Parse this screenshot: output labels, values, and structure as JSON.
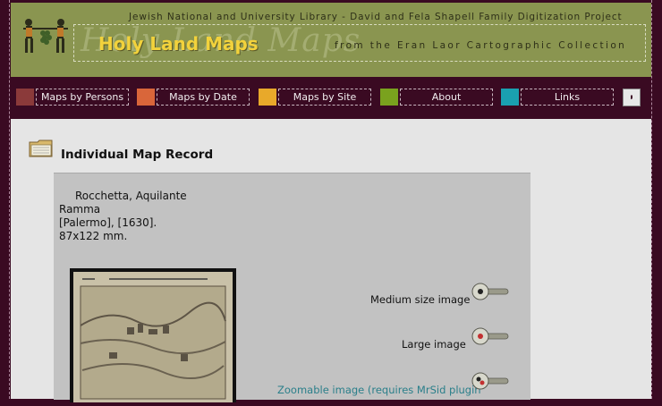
{
  "header": {
    "subtitle": "Jewish National and University Library - David and Fela Shapell Family Digitization Project",
    "title": "Holy Land Maps",
    "watermark": "Holy Land Maps",
    "collection": "from the Eran Laor Cartographic Collection"
  },
  "nav": {
    "items": [
      {
        "label": "Maps by Persons",
        "color": "#8b3a3a"
      },
      {
        "label": "Maps by Date",
        "color": "#d9663a"
      },
      {
        "label": "Maps by Site",
        "color": "#e8a92a"
      },
      {
        "label": "About",
        "color": "#7aa21e"
      },
      {
        "label": "Links",
        "color": "#1aa0b0"
      }
    ],
    "hebrew_link": "י"
  },
  "record": {
    "heading": "Individual Map Record",
    "author": "Rocchetta, Aquilante",
    "place": "Ramma",
    "publication": "[Palermo], [1630].",
    "size": "87x122 mm.",
    "options": {
      "medium": "Medium size image",
      "large": "Large image",
      "zoomable": "Zoomable image (requires MrSid plugin"
    }
  }
}
